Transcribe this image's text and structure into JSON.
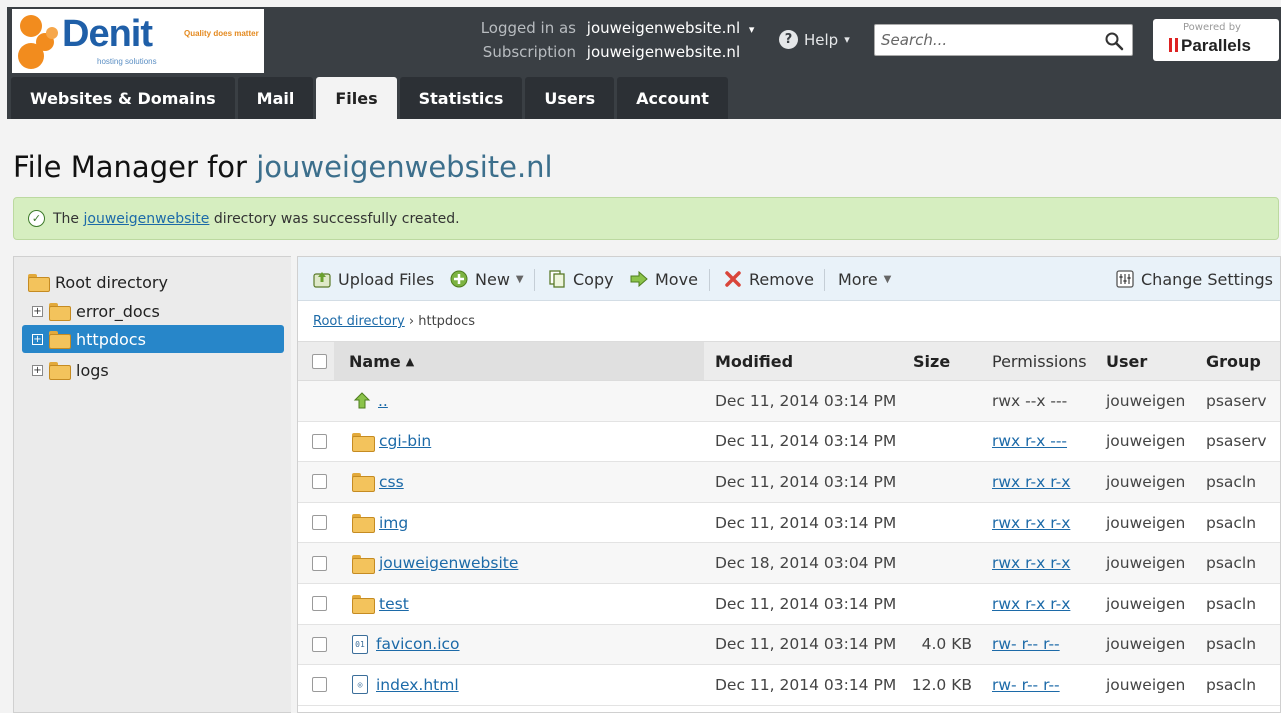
{
  "header": {
    "logo": {
      "brand": "Denit",
      "subtitle": "hosting solutions",
      "tagline": "Quality does matter"
    },
    "logged_in_label": "Logged in as",
    "logged_in_value": "jouweigenwebsite.nl",
    "subscription_label": "Subscription",
    "subscription_value": "jouweigenwebsite.nl",
    "help_label": "Help",
    "search_placeholder": "Search...",
    "powered_by": "Powered by",
    "powered_brand": "Parallels"
  },
  "tabs": [
    {
      "label": "Websites & Domains",
      "active": false
    },
    {
      "label": "Mail",
      "active": false
    },
    {
      "label": "Files",
      "active": true
    },
    {
      "label": "Statistics",
      "active": false
    },
    {
      "label": "Users",
      "active": false
    },
    {
      "label": "Account",
      "active": false
    }
  ],
  "page": {
    "title_prefix": "File Manager for",
    "title_domain": "jouweigenwebsite.nl"
  },
  "message": {
    "pre": "The",
    "link": "jouweigenwebsite",
    "post": "directory was successfully created."
  },
  "tree": {
    "root": "Root directory",
    "items": [
      {
        "label": "error_docs",
        "selected": false,
        "expander": "+"
      },
      {
        "label": "httpdocs",
        "selected": true,
        "expander": "+"
      },
      {
        "label": "logs",
        "selected": false,
        "expander": "+"
      }
    ]
  },
  "toolbar": {
    "upload": "Upload Files",
    "new": "New",
    "copy": "Copy",
    "move": "Move",
    "remove": "Remove",
    "more": "More",
    "change_settings": "Change Settings"
  },
  "breadcrumb": {
    "root": "Root directory",
    "separator": "›",
    "current": "httpdocs"
  },
  "table": {
    "columns": {
      "name": "Name",
      "modified": "Modified",
      "size": "Size",
      "permissions": "Permissions",
      "user": "User",
      "group": "Group"
    },
    "rows": [
      {
        "type": "up",
        "name": "..",
        "modified": "Dec 11, 2014 03:14 PM",
        "size": "",
        "permissions": "rwx --x ---",
        "perm_link": false,
        "user": "jouweigen",
        "group": "psaserv",
        "checkbox": false
      },
      {
        "type": "folder",
        "name": "cgi-bin",
        "modified": "Dec 11, 2014 03:14 PM",
        "size": "",
        "permissions": "rwx r-x ---",
        "perm_link": true,
        "user": "jouweigen",
        "group": "psaserv",
        "checkbox": true
      },
      {
        "type": "folder",
        "name": "css",
        "modified": "Dec 11, 2014 03:14 PM",
        "size": "",
        "permissions": "rwx r-x r-x",
        "perm_link": true,
        "user": "jouweigen",
        "group": "psacln",
        "checkbox": true
      },
      {
        "type": "folder",
        "name": "img",
        "modified": "Dec 11, 2014 03:14 PM",
        "size": "",
        "permissions": "rwx r-x r-x",
        "perm_link": true,
        "user": "jouweigen",
        "group": "psacln",
        "checkbox": true
      },
      {
        "type": "folder",
        "name": "jouweigenwebsite",
        "modified": "Dec 18, 2014 03:04 PM",
        "size": "",
        "permissions": "rwx r-x r-x",
        "perm_link": true,
        "user": "jouweigen",
        "group": "psacln",
        "checkbox": true
      },
      {
        "type": "folder",
        "name": "test",
        "modified": "Dec 11, 2014 03:14 PM",
        "size": "",
        "permissions": "rwx r-x r-x",
        "perm_link": true,
        "user": "jouweigen",
        "group": "psacln",
        "checkbox": true
      },
      {
        "type": "binary",
        "name": "favicon.ico",
        "modified": "Dec 11, 2014 03:14 PM",
        "size": "4.0 KB",
        "permissions": "rw- r-- r--",
        "perm_link": true,
        "user": "jouweigen",
        "group": "psacln",
        "checkbox": true
      },
      {
        "type": "html",
        "name": "index.html",
        "modified": "Dec 11, 2014 03:14 PM",
        "size": "12.0 KB",
        "permissions": "rw- r-- r--",
        "perm_link": true,
        "user": "jouweigen",
        "group": "psacln",
        "checkbox": true
      }
    ]
  }
}
